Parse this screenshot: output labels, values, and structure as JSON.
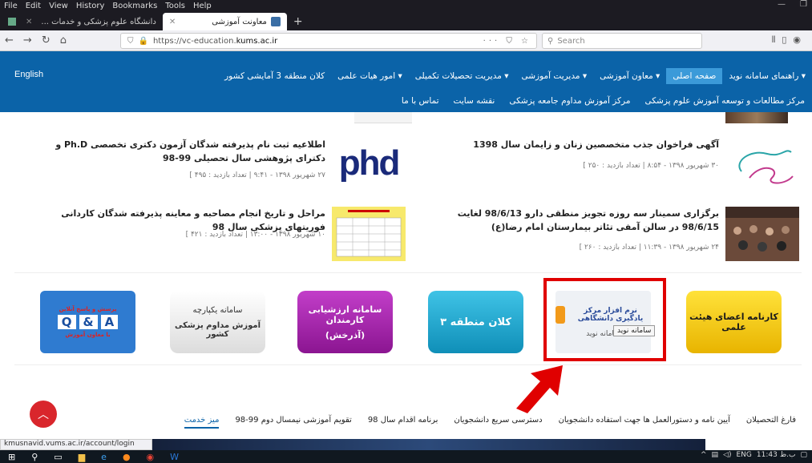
{
  "menubar": {
    "items": [
      "File",
      "Edit",
      "View",
      "History",
      "Bookmarks",
      "Tools",
      "Help"
    ]
  },
  "tabs": [
    {
      "label": "دانشگاه علوم پزشکی و خدمات ...",
      "active": false
    },
    {
      "label": "معاونت آموزشی",
      "active": true
    }
  ],
  "navbar": {
    "url_prefix": "https://vc-education.",
    "url_domain": "kums.ac.ir",
    "url_actions": "··· ⛉ ☆",
    "search_placeholder": "Search"
  },
  "site_nav": {
    "english": "English",
    "row1": [
      {
        "label": "راهنمای سامانه نوید ▾",
        "active": false
      },
      {
        "label": "صفحه اصلی",
        "active": true
      },
      {
        "label": "معاون آموزشی ▾",
        "active": false
      },
      {
        "label": "مدیریت آموزشی ▾",
        "active": false
      },
      {
        "label": "مدیریت تحصیلات تکمیلی ▾",
        "active": false
      },
      {
        "label": "امور هیات علمی ▾",
        "active": false
      },
      {
        "label": "کلان منطقه 3 آمایشی کشور",
        "active": false
      }
    ],
    "row2": [
      "مرکز مطالعات و توسعه آموزش علوم پزشکی",
      "مرکز آموزش مداوم جامعه پزشکی",
      "نقشه سایت",
      "تماس با ما"
    ]
  },
  "news": [
    {
      "title": "آگهی فراخوان جذب متخصصین زنان و زایمان سال 1398",
      "meta": "۳۰ شهریور ۱۳۹۸ - ۸:۵۴ | تعداد بازدید : ۲۵۰ ]"
    },
    {
      "title": "اطلاعیه ثبت نام پذیرفته شدگان آزمون دکتری تخصصی Ph.D و دکترای پژوهشی سال تحصیلی 99-98",
      "meta": "۲۷ شهریور ۱۳۹۸ - ۹:۴۱ | تعداد بازدید : ۴۹۵ ]"
    },
    {
      "title": "برگزاری سمینار سه روزه تجویز منطقی دارو 98/6/13 لغایت 98/6/15 در سالن آمفی تئاتر بیمارستان امام رضا(ع)",
      "meta": "۲۴ شهریور ۱۳۹۸ - ۱۱:۳۹ | تعداد بازدید : ۲۶۰ ]"
    },
    {
      "title": "مراحل و تاریخ انجام مصاحبه و معاینه پذیرفته شدگان کاردانی فوریتهای پزشکی سال 98",
      "meta": "۱۰ شهریور ۱۳۹۸ - ۱۳:۰۰ | تعداد بازدید : ۴۲۱ ]"
    }
  ],
  "thumbs": {
    "phd_text": "phd"
  },
  "services": {
    "faculty": "کارنامه اعضای هیئت علمی",
    "navid_logo": "نرم افزار مرکز یادگیری دانشگاهی",
    "navid_label": "سامانه نوید",
    "navid_tooltip": "سامانه نوید",
    "region": "کلان منطقه ۳",
    "eval_1": "سامانه ارزشیابی کارمندان",
    "eval_2": "(آذرخش)",
    "integrated_1": "سامانه یکپارچه",
    "integrated_2": "آموزش مداوم پزشکی کشور",
    "qa_q": "Q",
    "qa_and": "&",
    "qa_a": "A",
    "qa_top": "پرسش و پاسخ آنلاین",
    "qa_bottom": "با معاون آموزش"
  },
  "bottom_tabs": [
    {
      "label": "میز خدمت",
      "active": true
    },
    {
      "label": "تقویم آموزشی نیمسال دوم 99-98",
      "active": false
    },
    {
      "label": "برنامه اقدام سال 98",
      "active": false
    },
    {
      "label": "دسترسی سریع دانشجویان",
      "active": false
    },
    {
      "label": "آیین نامه و دستورالعمل ها جهت استفاده دانشجویان",
      "active": false
    },
    {
      "label": "فارغ التحصیلان",
      "active": false
    }
  ],
  "status_url": "kmusnavid.vums.ac.ir/account/login",
  "taskbar": {
    "lang": "ENG",
    "time": "11:43",
    "ampm": "ب.ظ"
  },
  "colors": {
    "site_nav": "#0b63a8",
    "highlight": "#e00000",
    "faculty_bg": "#f2c500",
    "eval_bg": "#a21ca8",
    "region_bg": "#1aa0c8"
  }
}
